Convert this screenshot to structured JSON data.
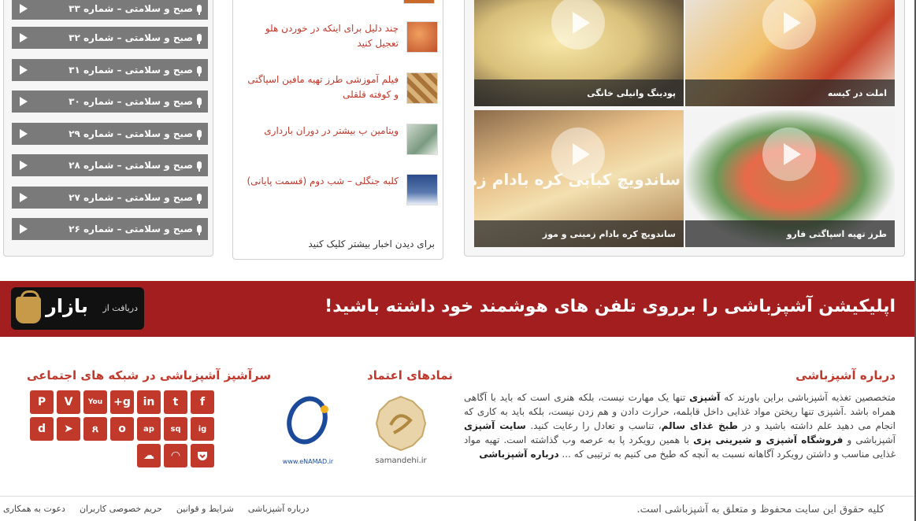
{
  "podcasts": [
    {
      "label": "صبح و سلامتی – شماره ۳۳"
    },
    {
      "label": "صبح و سلامتی – شماره ۳۲"
    },
    {
      "label": "صبح و سلامتی – شماره ۳۱"
    },
    {
      "label": "صبح و سلامتی – شماره ۳۰"
    },
    {
      "label": "صبح و سلامتی – شماره ۲۹"
    },
    {
      "label": "صبح و سلامتی – شماره ۲۸"
    },
    {
      "label": "صبح و سلامتی – شماره ۲۷"
    },
    {
      "label": "صبح و سلامتی – شماره ۲۶"
    }
  ],
  "news": [
    {
      "title": "چند دلیل برای اینکه در خوردن هلو تعجیل کنید",
      "color": "#e07a3a"
    },
    {
      "title": "فیلم آموزشی طرز تهیه مافین اسپاگتی و کوفته قلقلی",
      "color": "#b5894a"
    },
    {
      "title": "ویتامین ب بیشتر در دوران بارداری",
      "color": "#6f8f7a"
    },
    {
      "title": "کلبه جنگلی – شب دوم (قسمت پایانی)",
      "color": "#2f4f8f"
    }
  ],
  "news_more": "برای دیدن اخبار بیشتر کلیک کنید",
  "videos": [
    {
      "caption": "پودینگ وانیلی خانگی"
    },
    {
      "caption": "املت در کیسه"
    },
    {
      "caption": "ساندویچ کره بادام زمینی و موز",
      "overlay": "ساندویچ کبابی کره بادام زمینی و موز"
    },
    {
      "caption": "طرز تهیه اسپاگتی فارو"
    }
  ],
  "banner": {
    "title": "اپلیکیشن آشپزباشی را برروی تلفن های هوشمند خود داشته باشید!",
    "get_from": "دریافت از",
    "store": "بازار"
  },
  "footer": {
    "about_title": "درباره آشپزباشی",
    "about_text_1": "متخصصین تغذیه آشپزباشی براین باورند که ",
    "about_bold_1": "آشپزی",
    "about_text_2": " تنها یک مهارت نیست، بلکه هنری است که باید با آگاهی همراه باشد .آشپزی تنها ریختن مواد غذایی داخل قابلمه، حرارت دادن و هم زدن نیست، بلکه باید به کاری که انجام می دهید علم داشته باشید و در ",
    "about_bold_2": "طبخ غذای سالم",
    "about_text_3": "، تناسب و تعادل را رعایت کنید. ",
    "about_bold_3": "سایت آشپزی",
    "about_text_4": " آشپزباشی و ",
    "about_bold_4": "فروشگاه آشپزی و شیرینی پزی",
    "about_text_5": " با همین رویکرد پا به عرصه وب گذاشته است. تهیه مواد غذایی مناسب و داشتن رویکرد آگاهانه نسبت به آنچه که طبخ می کنیم به ترتیبی که ... ",
    "about_bold_5": "درباره آشپزباشی",
    "trust_title": "نمادهای اعتماد",
    "samandehi": "samandehi.ir",
    "enamad": "www.eNAMAD.ir",
    "social_title": "سرآشپز آشپزباشی در شبکه های اجتماعی",
    "social_row1": [
      "f",
      "t",
      "in",
      "g+",
      "You",
      "V",
      "P"
    ],
    "social_row2": [
      "ig",
      "sq",
      "ap",
      "o",
      "ጸ",
      "➤",
      "d"
    ],
    "social_row3": [
      "◠",
      "☁"
    ],
    "copyright": "کلیه حقوق این سایت محفوظ و متعلق به آشپزباشی است.",
    "links": [
      "درباره آشپزباشی",
      "شرایط و قوانین",
      "حریم خصوصی کاربران",
      "دعوت به همکاری"
    ]
  }
}
